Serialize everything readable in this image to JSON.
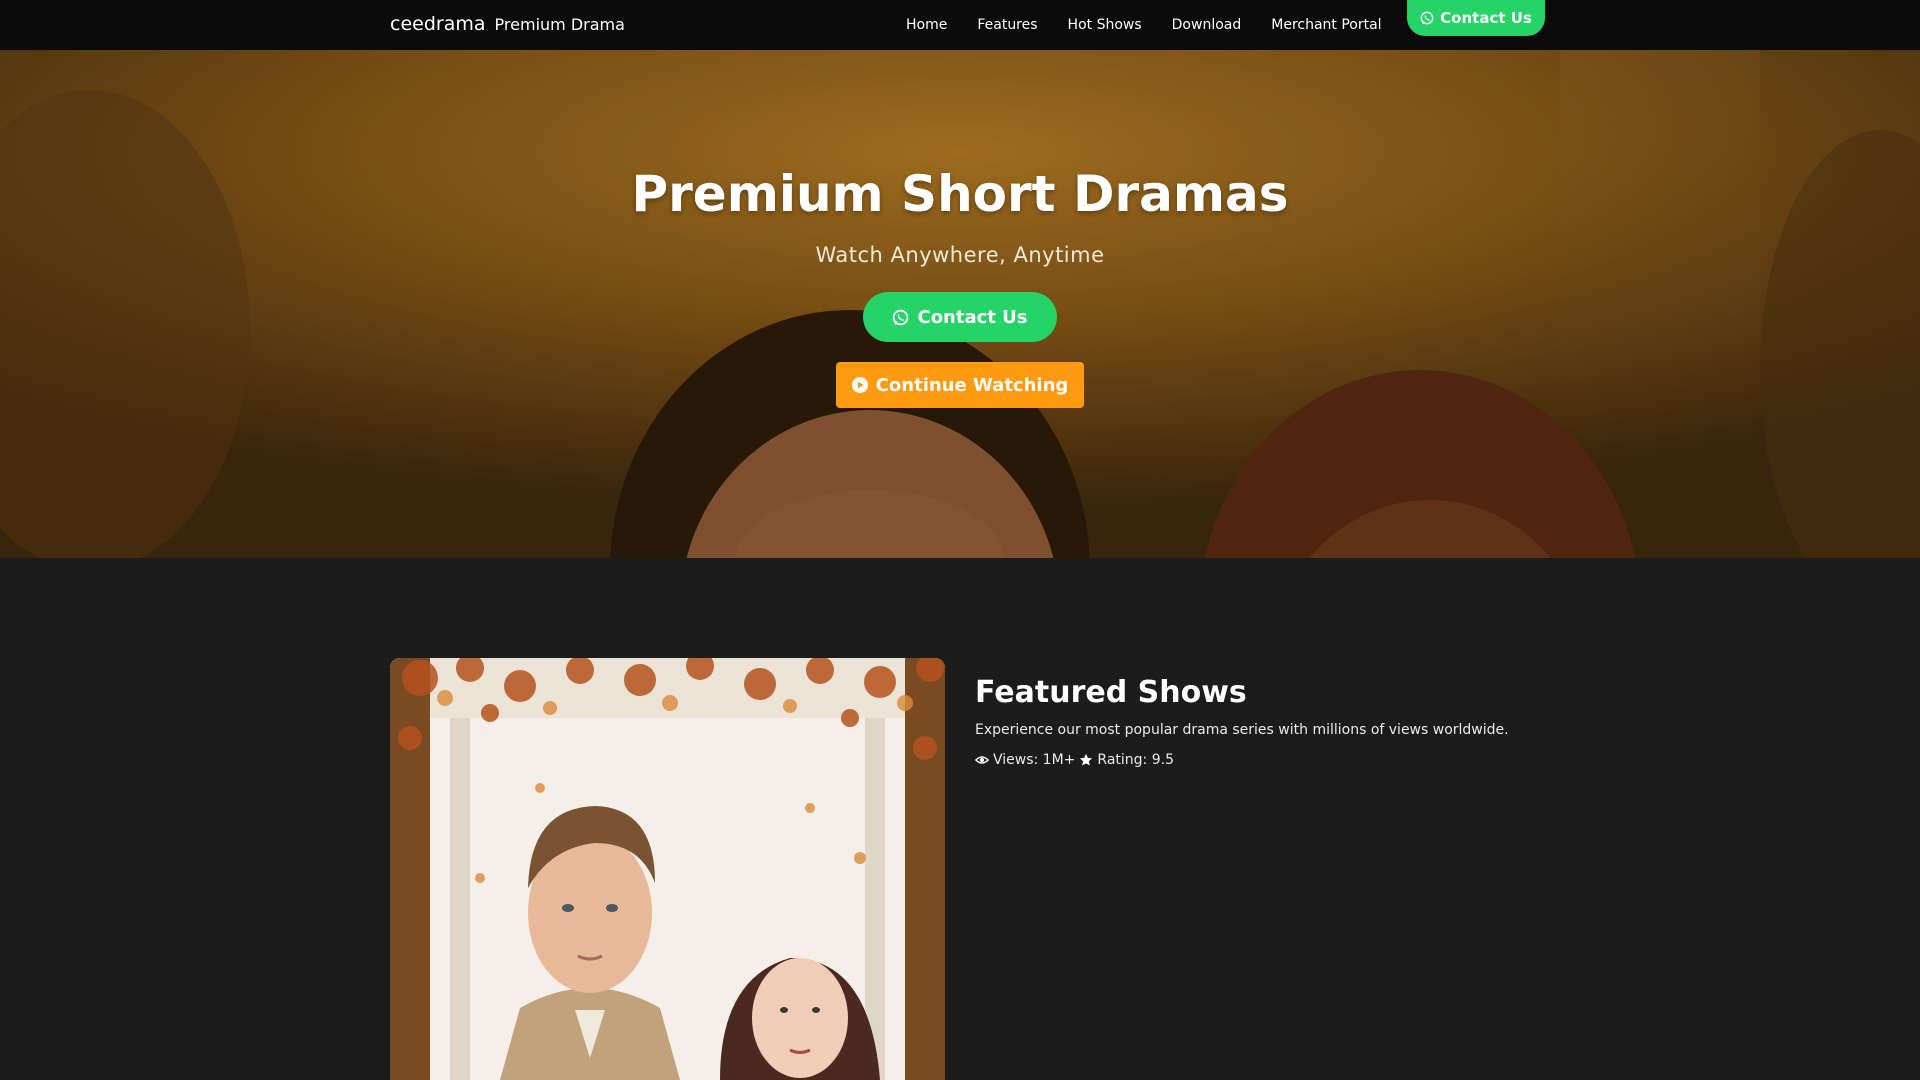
{
  "navbar": {
    "brand": "ceedrama",
    "brand_sub": "Premium Drama",
    "links": [
      "Home",
      "Features",
      "Hot Shows",
      "Download",
      "Merchant Portal"
    ],
    "contact_label": "Contact Us"
  },
  "hero": {
    "title": "Premium Short Dramas",
    "subtitle": "Watch Anywhere, Anytime",
    "contact_label": "Contact Us",
    "watch_label": "Continue Watching"
  },
  "featured": {
    "title": "Featured Shows",
    "description": "Experience our most popular drama series with millions of views worldwide.",
    "views": "Views: 1M+",
    "rating": "Rating: 9.5"
  },
  "icons": {
    "whatsapp": "whatsapp-icon",
    "play": "play-circle-icon",
    "eye": "eye-icon",
    "star": "star-icon"
  },
  "colors": {
    "whatsapp_green": "#25d366",
    "watch_orange": "#ff9a12",
    "navbar_bg": "#0b0b0b",
    "page_bg": "#1c1c1c"
  }
}
